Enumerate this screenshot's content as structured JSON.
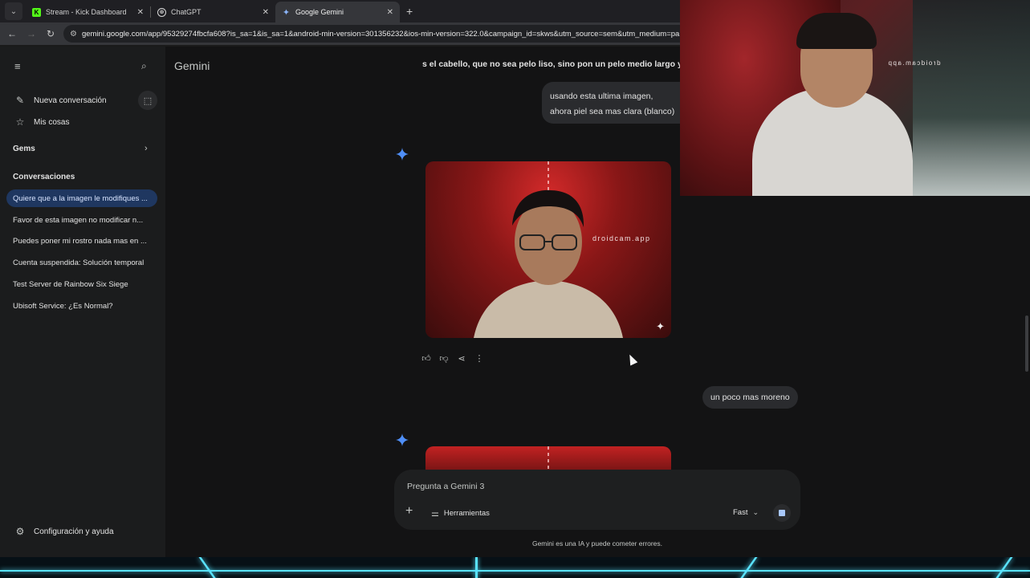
{
  "browser": {
    "tabs": [
      {
        "label": "Stream - Kick Dashboard",
        "favicon": "kick-icon",
        "color": "#53fc18"
      },
      {
        "label": "ChatGPT",
        "favicon": "chatgpt-icon",
        "color": "#d9d9d9"
      },
      {
        "label": "Google Gemini",
        "favicon": "gemini-icon",
        "color": "#8ab4f8",
        "active": true
      }
    ],
    "url": "gemini.google.com/app/95329274fbcfa608?is_sa=1&is_sa=1&android-min-version=301356232&ios-min-version=322.0&campaign_id=skws&utm_source=sem&utm_medium=paid"
  },
  "sidebar": {
    "new_chat": "Nueva conversación",
    "my_stuff": "Mis cosas",
    "gems": "Gems",
    "conversations_header": "Conversaciones",
    "conversations": [
      "Quiere que a la imagen le modifiques ...",
      "Favor de esta imagen no modificar n...",
      "Puedes poner mi rostro nada mas en ...",
      "Cuenta suspendida: Solución temporal",
      "Test Server de Rainbow Six Siege",
      "Ubisoft Service: ¿Es Normal?"
    ],
    "settings": "Configuración y ayuda"
  },
  "main": {
    "brand": "Gemini",
    "prev_message_fragment": "s el cabello, que no sea pelo liso, sino pon un pelo medio largo y",
    "user_message_1": "usando esta ultima imagen, ahora piel sea mas clara (blanco)",
    "image_watermark": "droidcam.app",
    "user_message_2": "un poco mas moreno",
    "input_placeholder": "Pregunta a Gemini 3",
    "tools_label": "Herramientas",
    "model_label": "Fast",
    "disclaimer": "Gemini es una IA y puede cometer errores."
  },
  "webcam": {
    "watermark": "droidcam.app"
  },
  "colors": {
    "accent": "#a8c7fa",
    "active_conversation": "#1f3760",
    "gemini_spark": "#4f8ff7",
    "neon": "#59e3ff"
  }
}
